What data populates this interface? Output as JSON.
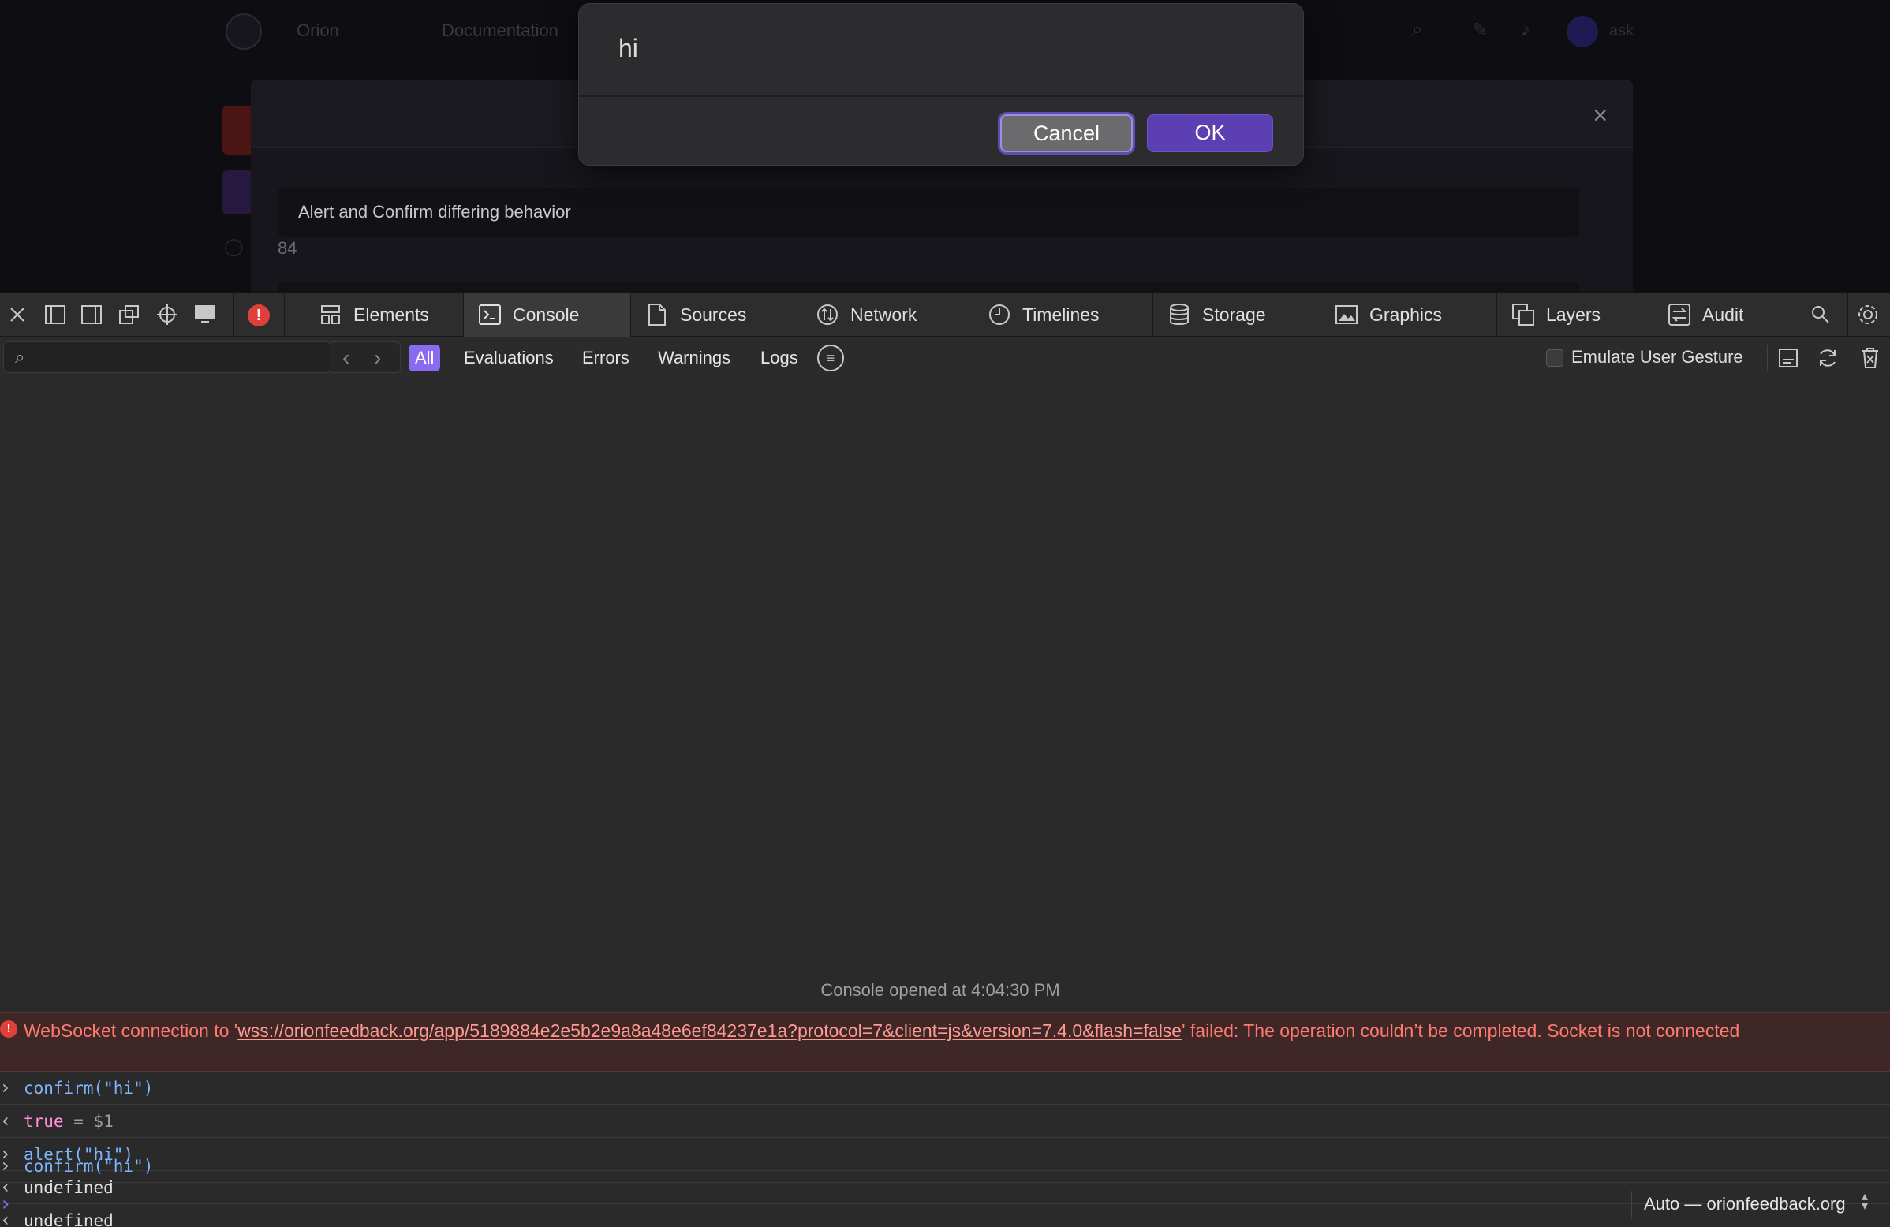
{
  "background_page": {
    "nav": {
      "link_1": "Orion",
      "link_2": "Documentation",
      "user": "ask"
    },
    "feedback": {
      "title": "Alert and Confirm differing behavior",
      "count": "84"
    },
    "close_glyph": "×"
  },
  "dialog": {
    "message": "hi",
    "cancel_label": "Cancel",
    "ok_label": "OK"
  },
  "devtools": {
    "tabs": [
      {
        "label": "Elements",
        "icon": "elements-icon"
      },
      {
        "label": "Console",
        "icon": "console-icon",
        "active": true
      },
      {
        "label": "Sources",
        "icon": "sources-icon"
      },
      {
        "label": "Network",
        "icon": "network-icon"
      },
      {
        "label": "Timelines",
        "icon": "timelines-icon"
      },
      {
        "label": "Storage",
        "icon": "storage-icon"
      },
      {
        "label": "Graphics",
        "icon": "graphics-icon"
      },
      {
        "label": "Layers",
        "icon": "layers-icon"
      },
      {
        "label": "Audit",
        "icon": "audit-icon"
      }
    ],
    "error_badge": "!",
    "filters": [
      "All",
      "Evaluations",
      "Errors",
      "Warnings",
      "Logs"
    ],
    "active_filter": "All",
    "emulate_gesture_label": "Emulate User Gesture",
    "console": {
      "opened_text": "Console opened at 4:04:30 PM",
      "error": {
        "prefix": "WebSocket connection to '",
        "url": "wss://orionfeedback.org/app/5189884e2e5b2e9a8a48e6ef84237e1a?protocol=7&client=js&version=7.4.0&flash=false",
        "suffix": "' failed: The operation couldn’t be completed. Socket is not connected"
      },
      "rows": [
        {
          "kind": "input",
          "text": "confirm(\"hi\")"
        },
        {
          "kind": "output",
          "keyword": "true",
          "extra": " = $1"
        },
        {
          "kind": "input",
          "text": "alert(\"hi\")"
        },
        {
          "kind": "output",
          "text": "undefined"
        },
        {
          "kind": "output",
          "text": "undefined"
        },
        {
          "kind": "input",
          "text": "confirm(\"hi\")"
        }
      ]
    },
    "context_selector": "Auto — orionfeedback.org"
  },
  "colors": {
    "accent": "#8a6bef",
    "ok_button": "#5b3fb3",
    "error_text": "#ff7a6e",
    "error_bg": "#3e2726"
  }
}
